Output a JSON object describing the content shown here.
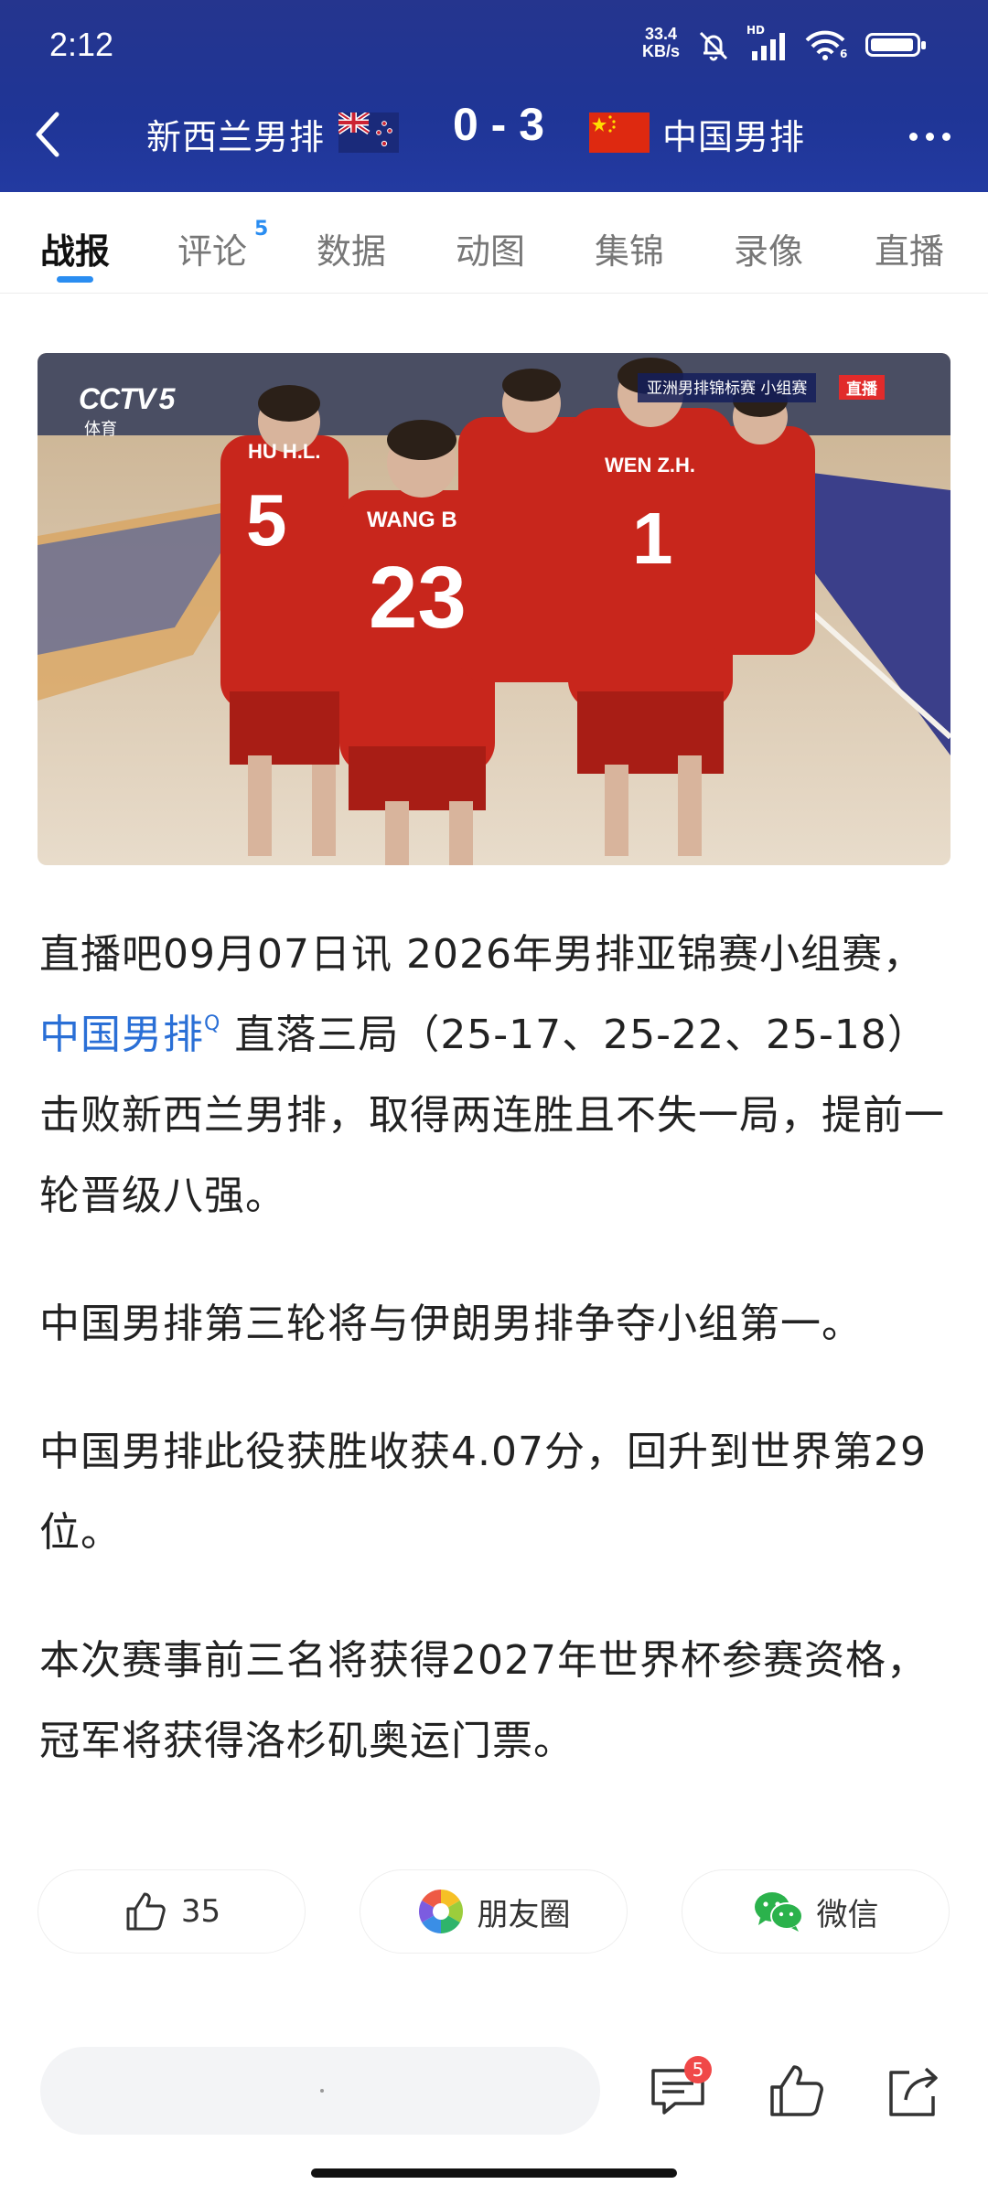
{
  "status_bar": {
    "time": "2:12",
    "net_speed_value": "33.4",
    "net_speed_unit": "KB/s",
    "signal_label": "HD",
    "wifi_label": "6"
  },
  "match": {
    "team_home": "新西兰男排",
    "score": "0 - 3",
    "team_away": "中国男排"
  },
  "tabs": [
    {
      "label": "战报",
      "active": true
    },
    {
      "label": "评论",
      "badge": "5"
    },
    {
      "label": "数据"
    },
    {
      "label": "动图"
    },
    {
      "label": "集锦"
    },
    {
      "label": "录像"
    },
    {
      "label": "直播"
    }
  ],
  "photo": {
    "channel_logo": "CCTV",
    "channel_number": "5",
    "channel_sub": "体育",
    "banner": "亚洲男排锦标赛 小组赛",
    "live_tag": "直播",
    "jersey_names": [
      "HU H.L.",
      "WANG B",
      "WEN Z.H."
    ],
    "jersey_numbers": [
      "5",
      "23",
      "1"
    ]
  },
  "article": {
    "p1_part1": "直播吧09月07日讯 2026年男排亚锦赛小组赛，",
    "p1_link": "中国男排",
    "p1_link_mark": "Q",
    "p1_part2": " 直落三局（25-17、25-22、25-18）击败新西兰男排，取得两连胜且不失一局，提前一轮晋级八强。",
    "p2": "中国男排第三轮将与伊朗男排争夺小组第一。",
    "p3": "中国男排此役获胜收获4.07分，回升到世界第29位。",
    "p4": "本次赛事前三名将获得2027年世界杯参赛资格，冠军将获得洛杉矶奥运门票。"
  },
  "share": {
    "like_count": "35",
    "moments_label": "朋友圈",
    "wechat_label": "微信"
  },
  "bottom_bar": {
    "comment_badge": "5"
  },
  "colors": {
    "header_bg": "#2337a0",
    "accent_blue": "#2a8df1",
    "link_blue": "#2a6fd6",
    "badge_red": "#f04848"
  }
}
